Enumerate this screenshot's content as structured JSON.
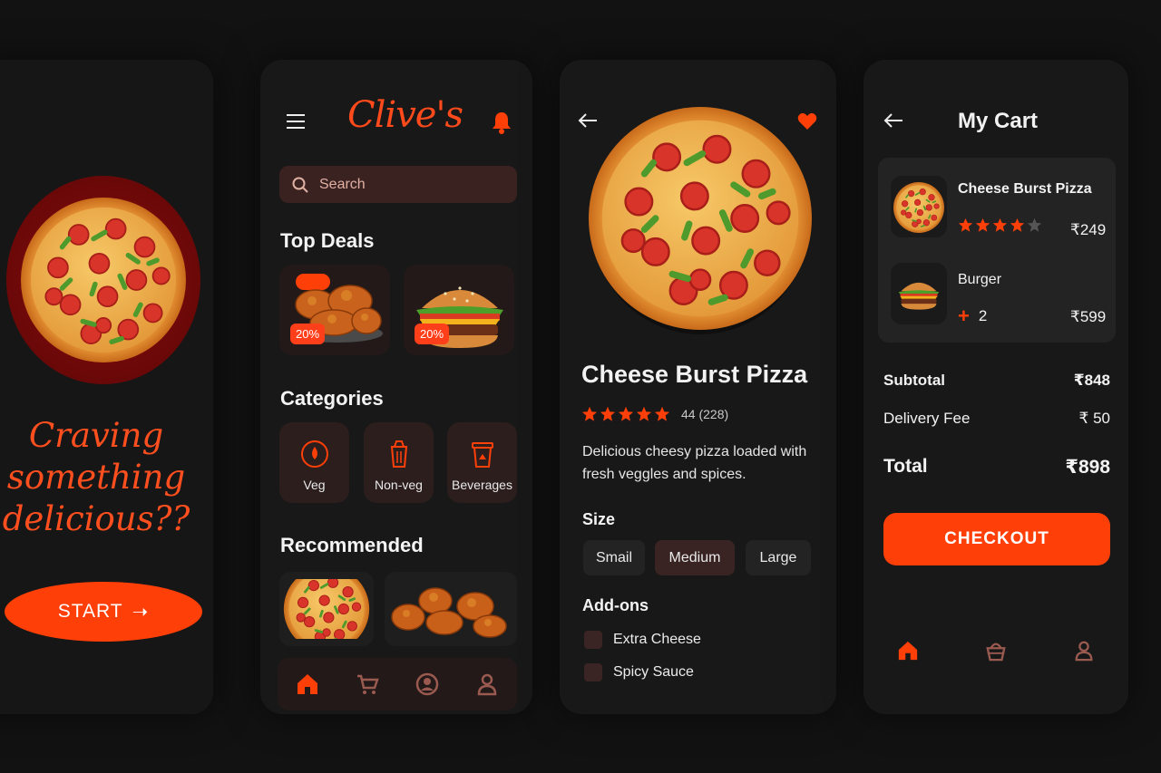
{
  "colors": {
    "accent": "#ff3f08",
    "background": "#121212",
    "card": "#181818"
  },
  "intro": {
    "headline_lines": [
      "Craving",
      "something",
      "delicious??"
    ],
    "start_label": "START",
    "start_arrow": "➝"
  },
  "home": {
    "brand": "Clive's",
    "search_placeholder": "Search",
    "top_deals_title": "Top Deals",
    "deals": [
      {
        "name": "fried chicken",
        "badge": "20%"
      },
      {
        "name": "burger",
        "badge": "20%"
      }
    ],
    "categories_title": "Categories",
    "categories": [
      {
        "label": "Veg",
        "icon": "veg-drop-icon"
      },
      {
        "label": "Non-veg",
        "icon": "non-veg-cup-icon"
      },
      {
        "label": "Beverages",
        "icon": "beverage-cup-icon"
      }
    ],
    "recommended_title": "Recommended",
    "nav_icons": [
      "home-icon",
      "cart-icon",
      "profile-circle-icon",
      "user-icon"
    ]
  },
  "detail": {
    "title": "Cheese Burst Pizza",
    "stars": 5,
    "rating_text": "44 (228)",
    "description": "Delicious cheesy pizza loaded with fresh veggles and spices.",
    "size_title": "Size",
    "sizes": [
      "Smail",
      "Medium",
      "Large"
    ],
    "selected_size": "Medium",
    "addons_title": "Add-ons",
    "addons": [
      "Extra Cheese",
      "Spicy Sauce"
    ]
  },
  "cart": {
    "title": "My Cart",
    "items": [
      {
        "name": "Cheese Burst Pizza",
        "stars": 4,
        "price": "₹249"
      },
      {
        "name": "Burger",
        "plus": "+",
        "qty": "2",
        "price": "₹599"
      }
    ],
    "subtotal_label": "Subtotal",
    "subtotal_value": "₹848",
    "delivery_label": "Delivery Fee",
    "delivery_value": "₹ 50",
    "total_label": "Total",
    "total_value": "₹898",
    "checkout_label": "CHECKOUT",
    "nav_icons": [
      "home-icon",
      "basket-icon",
      "user-icon"
    ]
  }
}
